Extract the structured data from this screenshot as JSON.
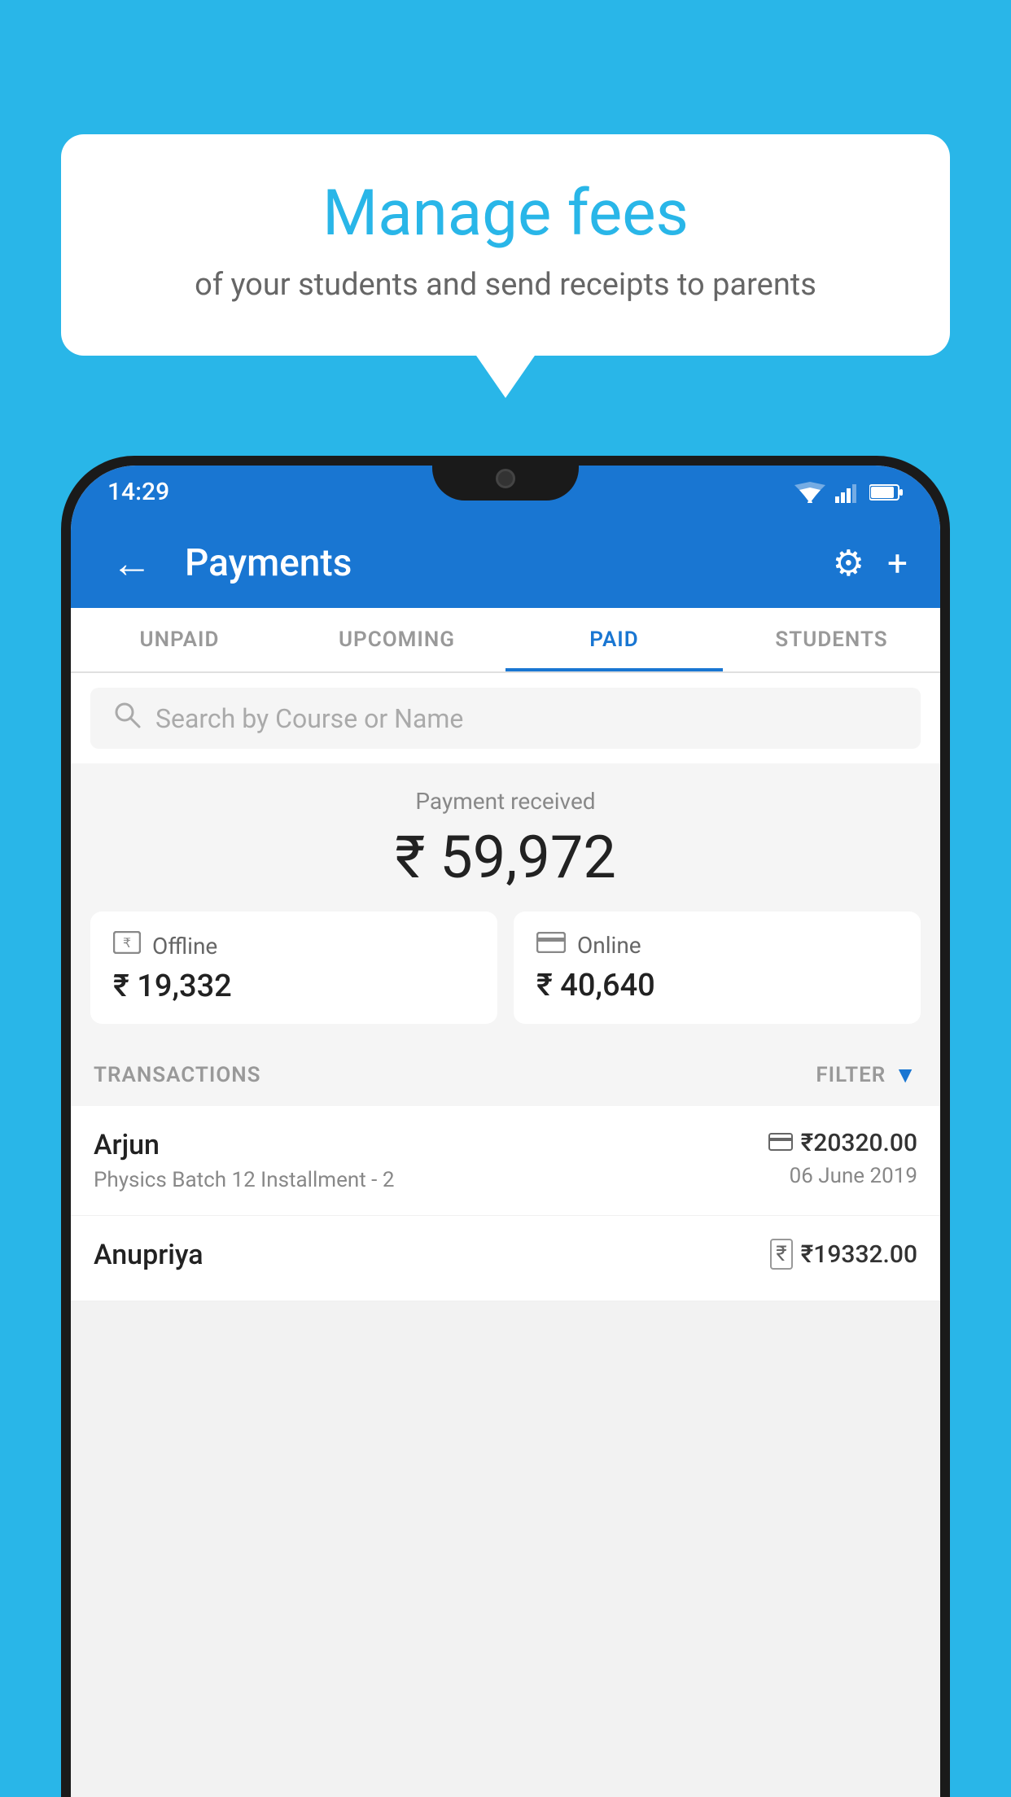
{
  "background_color": "#29B6E8",
  "bubble": {
    "title": "Manage fees",
    "subtitle": "of your students and send receipts to parents"
  },
  "status_bar": {
    "time": "14:29",
    "wifi": "wifi",
    "signal": "signal",
    "battery": "battery"
  },
  "app_bar": {
    "title": "Payments",
    "back_label": "←",
    "gear_label": "⚙",
    "add_label": "+"
  },
  "tabs": [
    {
      "label": "UNPAID",
      "active": false
    },
    {
      "label": "UPCOMING",
      "active": false
    },
    {
      "label": "PAID",
      "active": true
    },
    {
      "label": "STUDENTS",
      "active": false
    }
  ],
  "search": {
    "placeholder": "Search by Course or Name"
  },
  "payment_summary": {
    "label": "Payment received",
    "amount": "₹ 59,972",
    "offline": {
      "icon": "rupee-box",
      "label": "Offline",
      "amount": "₹ 19,332"
    },
    "online": {
      "icon": "card",
      "label": "Online",
      "amount": "₹ 40,640"
    }
  },
  "transactions_section": {
    "label": "TRANSACTIONS",
    "filter_label": "FILTER"
  },
  "transactions": [
    {
      "name": "Arjun",
      "detail": "Physics Batch 12 Installment - 2",
      "amount": "₹20320.00",
      "date": "06 June 2019",
      "icon": "card"
    },
    {
      "name": "Anupriya",
      "detail": "",
      "amount": "₹19332.00",
      "date": "",
      "icon": "rupee-box"
    }
  ]
}
